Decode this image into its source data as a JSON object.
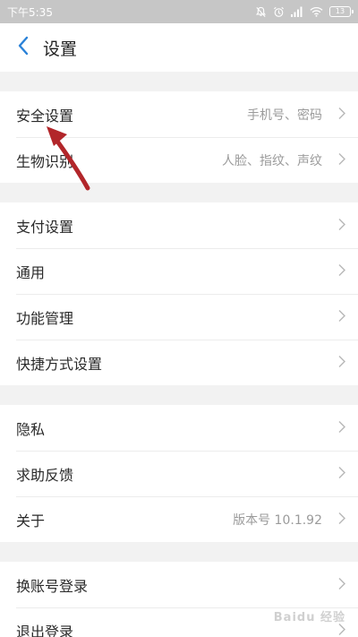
{
  "status_bar": {
    "time": "下午5:35",
    "battery": "13"
  },
  "header": {
    "title": "设置"
  },
  "groups": [
    {
      "items": [
        {
          "label": "安全设置",
          "value": "手机号、密码"
        },
        {
          "label": "生物识别",
          "value": "人脸、指纹、声纹"
        }
      ]
    },
    {
      "items": [
        {
          "label": "支付设置",
          "value": ""
        },
        {
          "label": "通用",
          "value": ""
        },
        {
          "label": "功能管理",
          "value": ""
        },
        {
          "label": "快捷方式设置",
          "value": ""
        }
      ]
    },
    {
      "items": [
        {
          "label": "隐私",
          "value": ""
        },
        {
          "label": "求助反馈",
          "value": ""
        },
        {
          "label": "关于",
          "value": "版本号 10.1.92"
        }
      ]
    },
    {
      "items": [
        {
          "label": "换账号登录",
          "value": ""
        },
        {
          "label": "退出登录",
          "value": ""
        }
      ]
    }
  ],
  "watermark": "Baidu 经验",
  "colors": {
    "accent": "#2a82d8",
    "annotation": "#b2262a",
    "status_bar": "#c6c6c6",
    "background": "#f2f2f2"
  }
}
